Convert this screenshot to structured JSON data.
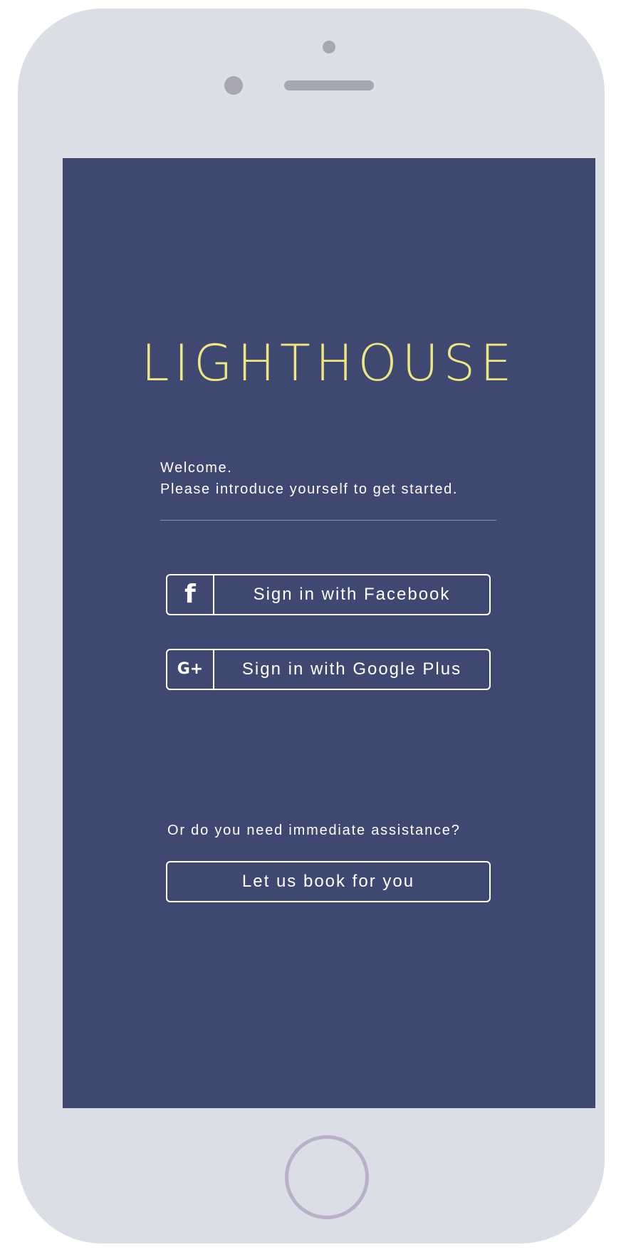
{
  "app": {
    "logo": "LIGHTHOUSE"
  },
  "intro": {
    "line1": "Welcome.",
    "line2": "Please introduce yourself to get started."
  },
  "auth": {
    "facebook_label": "Sign in with Facebook",
    "facebook_icon": "f",
    "google_label": "Sign in with Google Plus",
    "google_icon": "G+"
  },
  "assist": {
    "question": "Or do you need immediate assistance?",
    "book_label": "Let us book for you"
  },
  "colors": {
    "screen_background": "#3e4870",
    "logo": "#efe680",
    "text": "#ffffff",
    "device_frame": "#dcdee6"
  },
  "icons": {
    "facebook": "facebook-icon",
    "google_plus": "google-plus-icon"
  }
}
